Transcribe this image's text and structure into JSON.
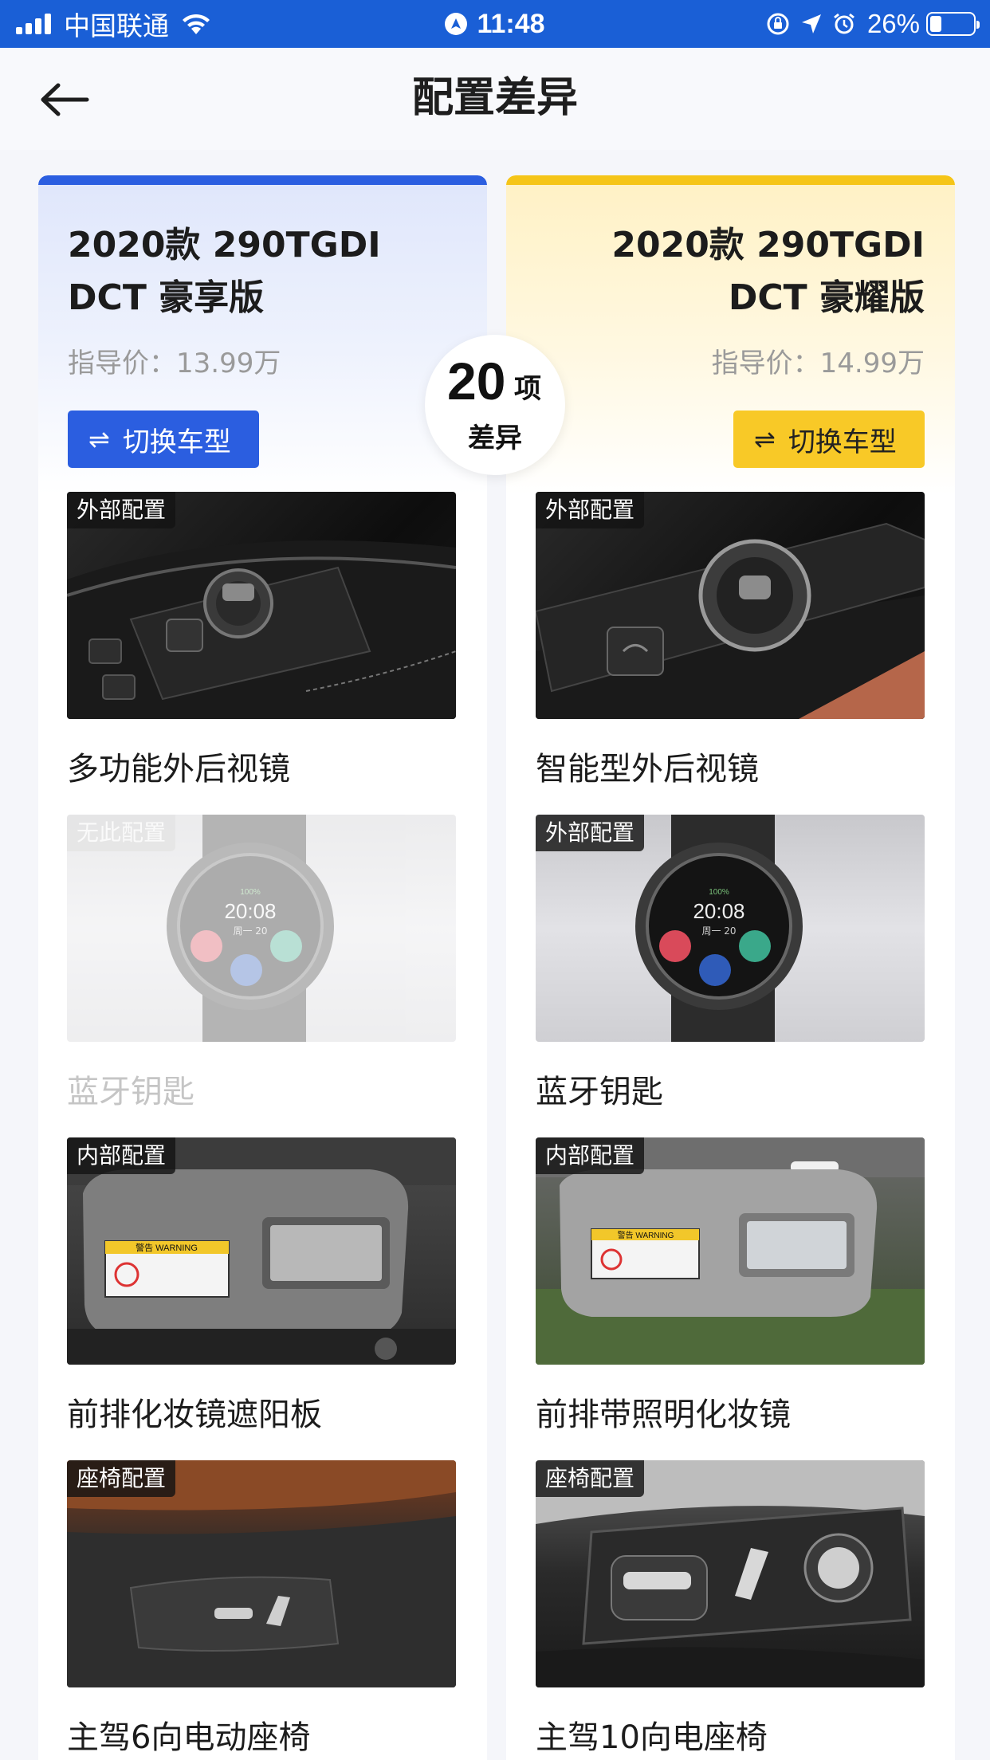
{
  "status_bar": {
    "carrier": "中国联通",
    "time": "11:48",
    "battery": "26%",
    "battery_level": 0.26
  },
  "nav": {
    "title": "配置差异",
    "back_icon": "arrow-left-icon"
  },
  "diff": {
    "count": "20",
    "unit": "项",
    "label": "差异"
  },
  "cars": [
    {
      "name": "2020款 290TGDI DCT 豪享版",
      "name_line1": "2020款 290TGDI",
      "name_line2": "DCT 豪享版",
      "price": "指导价：13.99万",
      "switch_label": "切换车型",
      "accent": "#2b5ee0",
      "items": [
        {
          "tag": "外部配置",
          "name": "多功能外后视镜",
          "available": true
        },
        {
          "tag": "无此配置",
          "name": "蓝牙钥匙",
          "available": false
        },
        {
          "tag": "内部配置",
          "name": "前排化妆镜遮阳板",
          "available": true
        },
        {
          "tag": "座椅配置",
          "name": "主驾6向电动座椅",
          "available": true
        }
      ]
    },
    {
      "name": "2020款 290TGDI DCT 豪耀版",
      "name_line1": "2020款 290TGDI",
      "name_line2": "DCT 豪耀版",
      "price": "指导价：14.99万",
      "switch_label": "切换车型",
      "accent": "#f5c518",
      "items": [
        {
          "tag": "外部配置",
          "name": "智能型外后视镜",
          "available": true
        },
        {
          "tag": "外部配置",
          "name": "蓝牙钥匙",
          "available": true
        },
        {
          "tag": "内部配置",
          "name": "前排带照明化妆镜",
          "available": true
        },
        {
          "tag": "座椅配置",
          "name": "主驾10向电座椅",
          "available": true
        }
      ]
    }
  ],
  "watch_text": {
    "time": "20:08",
    "date": "周一 20",
    "battery": "100%"
  },
  "visor_text": "警告 WARNING"
}
